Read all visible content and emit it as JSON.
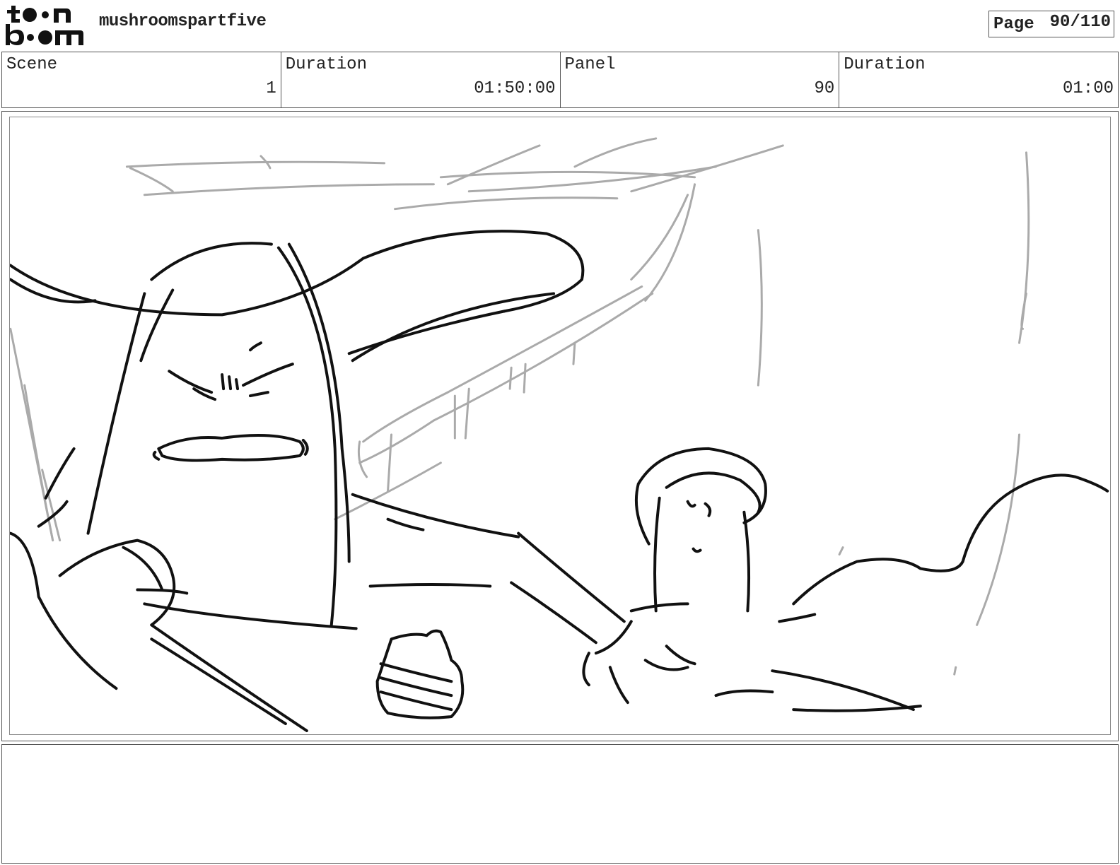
{
  "header": {
    "logo": {
      "top_text": "toon",
      "bottom_text": "boom",
      "icon": "toonboom-logo"
    },
    "project_title": "mushroomspartfive",
    "page_label": "Page",
    "page_value": "90/110"
  },
  "info": {
    "scene_label": "Scene",
    "scene_value": "1",
    "scene_duration_label": "Duration",
    "scene_duration_value": "01:50:00",
    "panel_label": "Panel",
    "panel_value": "90",
    "panel_duration_label": "Duration",
    "panel_duration_value": "01:00"
  },
  "panel": {
    "image": "storyboard-sketch"
  },
  "notes": {
    "text": ""
  },
  "colors": {
    "ink": "#111111",
    "rough": "#aaaaaa",
    "border": "#555555"
  }
}
